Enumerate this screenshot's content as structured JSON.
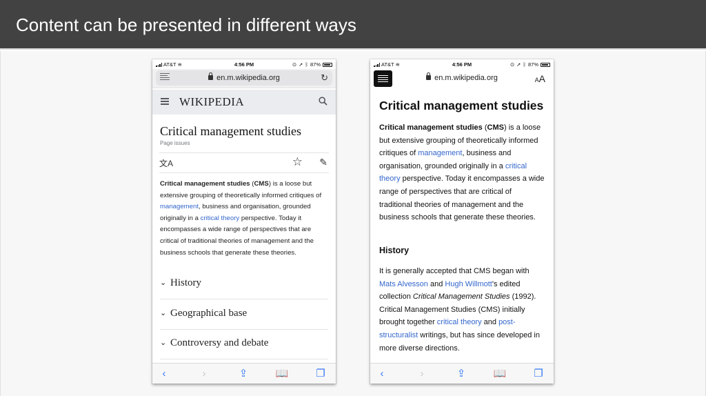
{
  "slide": {
    "title": "Content can be presented in different ways"
  },
  "statusbar": {
    "carrier": "AT&T",
    "time": "4:56 PM",
    "battery": "87%"
  },
  "browser": {
    "url": "en.m.wikipedia.org",
    "reader_aa": "AA"
  },
  "left_page": {
    "logo": "WIKIPEDIA",
    "title": "Critical management studies",
    "page_issues": "Page issues",
    "lead": {
      "bold1": "Critical management studies",
      "t1": " (",
      "bold2": "CMS",
      "t2": ") is a loose but extensive grouping of theoretically informed critiques of ",
      "link1": "management",
      "t3": ", business and organisation, grounded originally in a ",
      "link2": "critical theory",
      "t4": " perspective. Today it encompasses a wide range of perspectives that are critical of traditional theories of management and the business schools that generate these theories."
    },
    "sections": [
      "History",
      "Geographical base",
      "Controversy and debate"
    ]
  },
  "right_page": {
    "title": "Critical management studies",
    "para1": {
      "bold1": "Critical management studies",
      "t1": " (",
      "bold2": "CMS",
      "t2": ") is a loose but extensive grouping of theoretically informed critiques of ",
      "link1": "management",
      "t3": ", business and organisation, grounded originally in a ",
      "link2": "critical theory",
      "t4": " perspective. Today it encompasses a wide range of perspectives that are critical of traditional theories of management and the business schools that generate these theories."
    },
    "h2": "History",
    "para2": {
      "t1": "It is generally accepted that CMS began with ",
      "link1": "Mats Alvesson",
      "t2": " and ",
      "link2": "Hugh Willmott",
      "t3": "'s edited collection ",
      "italic": "Critical Management Studies",
      "t4": " (1992). Critical Management Studies (CMS) initially brought together ",
      "link3": "critical theory",
      "t5": " and ",
      "link4": "post-structuralist",
      "t6": " writings, but has since developed in more diverse directions."
    }
  },
  "icons": {
    "back": "back-icon",
    "forward": "forward-icon",
    "share": "share-icon",
    "bookmarks": "bookmarks-icon",
    "tabs": "tabs-icon"
  }
}
